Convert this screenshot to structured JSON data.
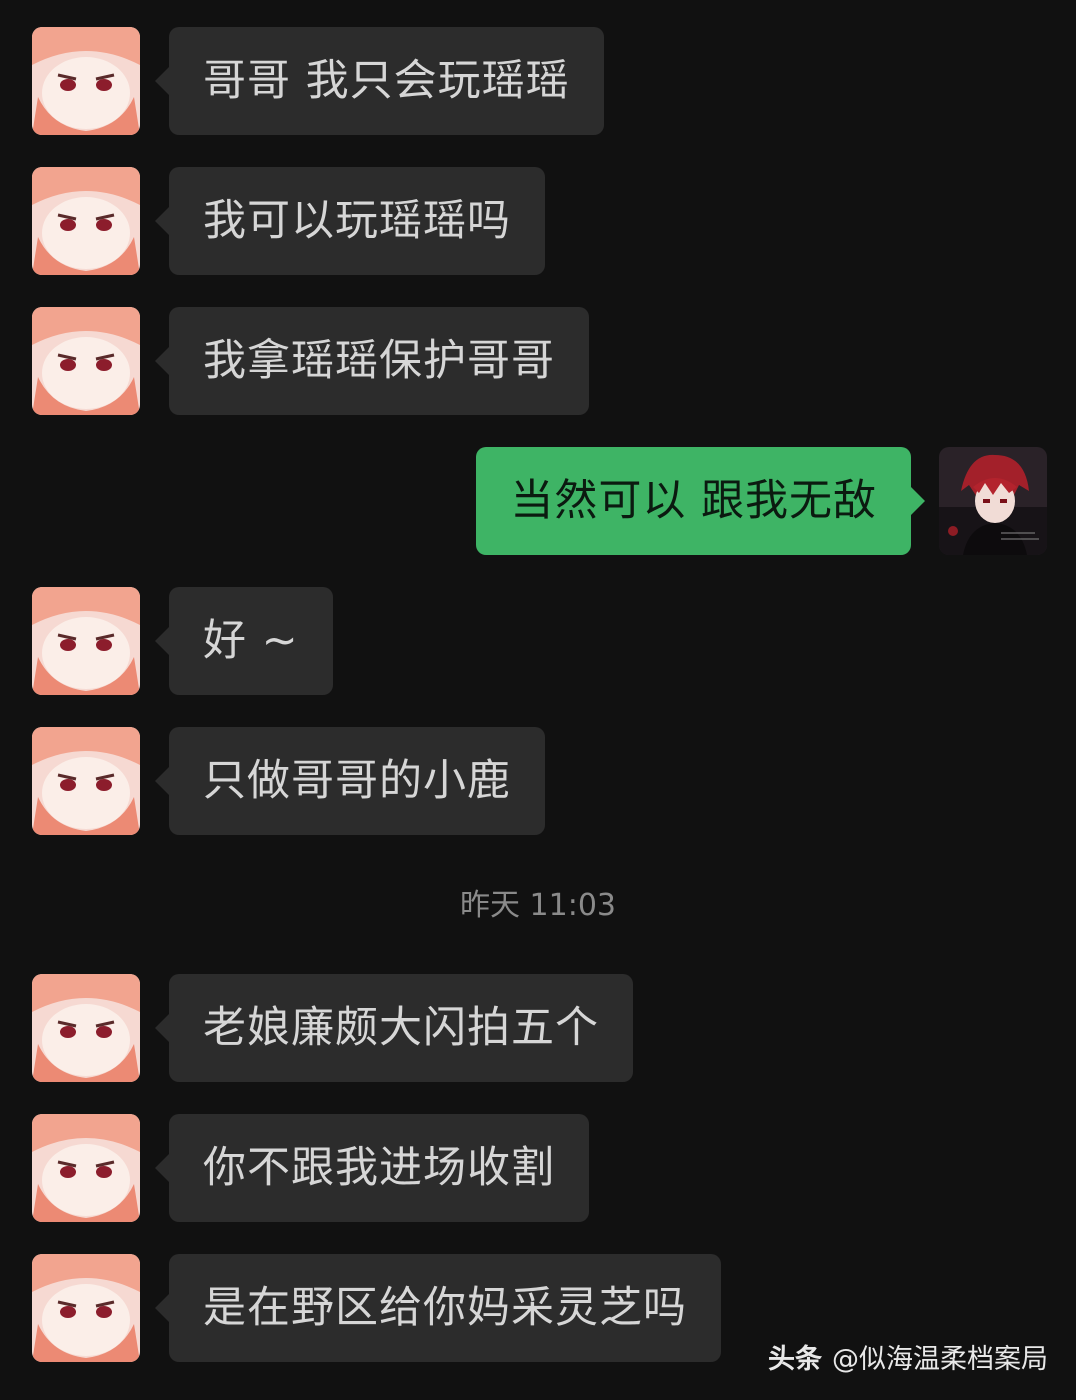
{
  "colors": {
    "background": "#111111",
    "incoming_bubble": "#2c2c2c",
    "outgoing_bubble": "#3eb465",
    "timestamp": "#8a8a8a"
  },
  "contact_avatar_icon": "anime-girl-avatar",
  "self_avatar_icon": "anime-boy-avatar",
  "messages": [
    {
      "side": "incoming",
      "text": "哥哥 我只会玩瑶瑶"
    },
    {
      "side": "incoming",
      "text": "我可以玩瑶瑶吗"
    },
    {
      "side": "incoming",
      "text": "我拿瑶瑶保护哥哥"
    },
    {
      "side": "outgoing",
      "text": "当然可以 跟我无敌"
    },
    {
      "side": "incoming",
      "text": "好 ~"
    },
    {
      "side": "incoming",
      "text": "只做哥哥的小鹿"
    },
    {
      "side": "incoming",
      "text": "老娘廉颇大闪拍五个"
    },
    {
      "side": "incoming",
      "text": "你不跟我进场收割"
    },
    {
      "side": "incoming",
      "text": "是在野区给你妈采灵芝吗"
    }
  ],
  "timestamp": "昨天 11:03",
  "watermark": {
    "brand": "头条",
    "handle": "@似海温柔档案局"
  }
}
